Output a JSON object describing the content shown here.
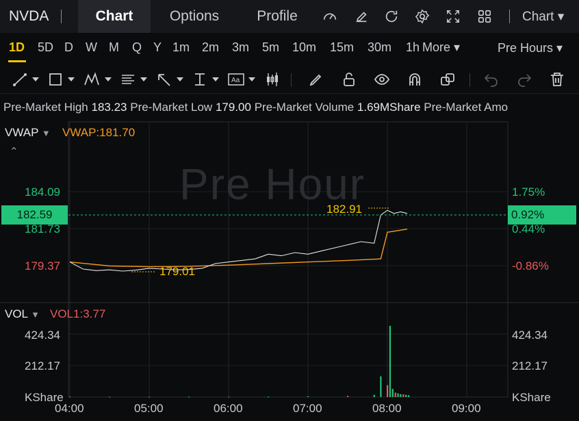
{
  "header": {
    "ticker": "NVDA",
    "tabs": [
      {
        "label": "Chart",
        "active": true
      },
      {
        "label": "Options",
        "active": false
      },
      {
        "label": "Profile",
        "active": false
      }
    ],
    "icons": [
      "gauge-icon",
      "edit-icon",
      "refresh-icon",
      "settings-icon",
      "fullscreen-icon",
      "grid-icon"
    ],
    "chart_menu": "Chart"
  },
  "periods": {
    "items": [
      "1D",
      "5D",
      "D",
      "W",
      "M",
      "Q",
      "Y",
      "1m",
      "2m",
      "3m",
      "5m",
      "10m",
      "15m",
      "30m",
      "1h"
    ],
    "active": "1D",
    "more": "More",
    "session": "Pre Hours"
  },
  "toolbar": {
    "tools": [
      "trendline-tool-icon",
      "rectangle-tool-icon",
      "pattern-tool-icon",
      "fibonacci-tool-icon",
      "arrow-tool-icon",
      "measure-tool-icon",
      "text-tool-icon",
      "candle-tool-icon",
      "pencil-icon",
      "lock-icon",
      "eye-icon",
      "magnet-icon",
      "copy-icon",
      "undo-icon",
      "redo-icon",
      "trash-icon"
    ]
  },
  "info": {
    "high_label": "Pre-Market High",
    "high_value": "183.23",
    "low_label": "Pre-Market Low",
    "low_value": "179.00",
    "volume_label": "Pre-Market Volume",
    "volume_value": "1.69MShare",
    "amount_label": "Pre-Market Amo"
  },
  "price_panel": {
    "indicator": "VWAP",
    "vwap_value": "VWAP:181.70",
    "watermark": "Pre Hour",
    "current_price": "182.59",
    "current_pct": "0.92%",
    "left_ticks": [
      "184.09",
      "181.73",
      "179.37"
    ],
    "right_ticks": [
      "1.75%",
      "0.44%",
      "-0.86%"
    ],
    "high_marker": "182.91",
    "low_marker": "179.01",
    "colors": {
      "up": "#22c47a",
      "down": "#e85a5a",
      "vwap": "#f59a1c",
      "marker": "#f5c400"
    }
  },
  "volume_panel": {
    "indicator": "VOL",
    "vol_value": "VOL1:3.77",
    "ticks": [
      "424.34",
      "212.17"
    ],
    "unit": "KShare"
  },
  "time_axis": [
    "04:00",
    "05:00",
    "06:00",
    "07:00",
    "08:00",
    "09:00"
  ],
  "chart_data": [
    {
      "type": "line",
      "title": "",
      "series": [
        {
          "name": "",
          "x": [
            "04:00",
            "04:10",
            "04:20",
            "04:30",
            "04:40",
            "04:50",
            "05:00",
            "05:10",
            "05:20",
            "05:30",
            "05:40",
            "05:50",
            "06:00",
            "06:10",
            "06:20",
            "06:30",
            "06:40",
            "06:50",
            "07:00",
            "07:10",
            "07:20",
            "07:30",
            "07:40",
            "07:50",
            "07:55",
            "08:00",
            "08:05",
            "08:10",
            "08:15"
          ],
          "y": [
            179.6,
            179.15,
            179.05,
            179.1,
            179.02,
            179.08,
            179.2,
            179.15,
            179.1,
            179.12,
            179.2,
            179.5,
            179.6,
            179.7,
            179.8,
            180.1,
            180.0,
            180.2,
            180.1,
            180.3,
            180.5,
            180.7,
            180.9,
            180.8,
            182.6,
            182.9,
            182.7,
            182.8,
            182.7
          ]
        },
        {
          "name": "VWAP",
          "x": [
            "04:00",
            "04:30",
            "05:00",
            "05:30",
            "06:00",
            "06:30",
            "07:00",
            "07:30",
            "07:55",
            "08:00",
            "08:15"
          ],
          "y": [
            179.6,
            179.35,
            179.3,
            179.32,
            179.4,
            179.5,
            179.6,
            179.7,
            179.8,
            181.5,
            181.7
          ]
        }
      ],
      "ylim": [
        178.5,
        185.0
      ],
      "xlim": [
        "04:00",
        "09:20"
      ]
    },
    {
      "type": "bar",
      "title": "",
      "x": [
        "04:00",
        "04:30",
        "05:00",
        "05:30",
        "06:00",
        "06:30",
        "07:00",
        "07:30",
        "07:50",
        "07:55",
        "08:00",
        "08:02",
        "08:04",
        "08:06",
        "08:08",
        "08:10",
        "08:12",
        "08:14",
        "08:16"
      ],
      "values": [
        3,
        2,
        2,
        3,
        2,
        3,
        5,
        8,
        15,
        140,
        80,
        480,
        55,
        30,
        25,
        20,
        18,
        15,
        12
      ],
      "ylim": [
        0,
        520
      ]
    }
  ]
}
